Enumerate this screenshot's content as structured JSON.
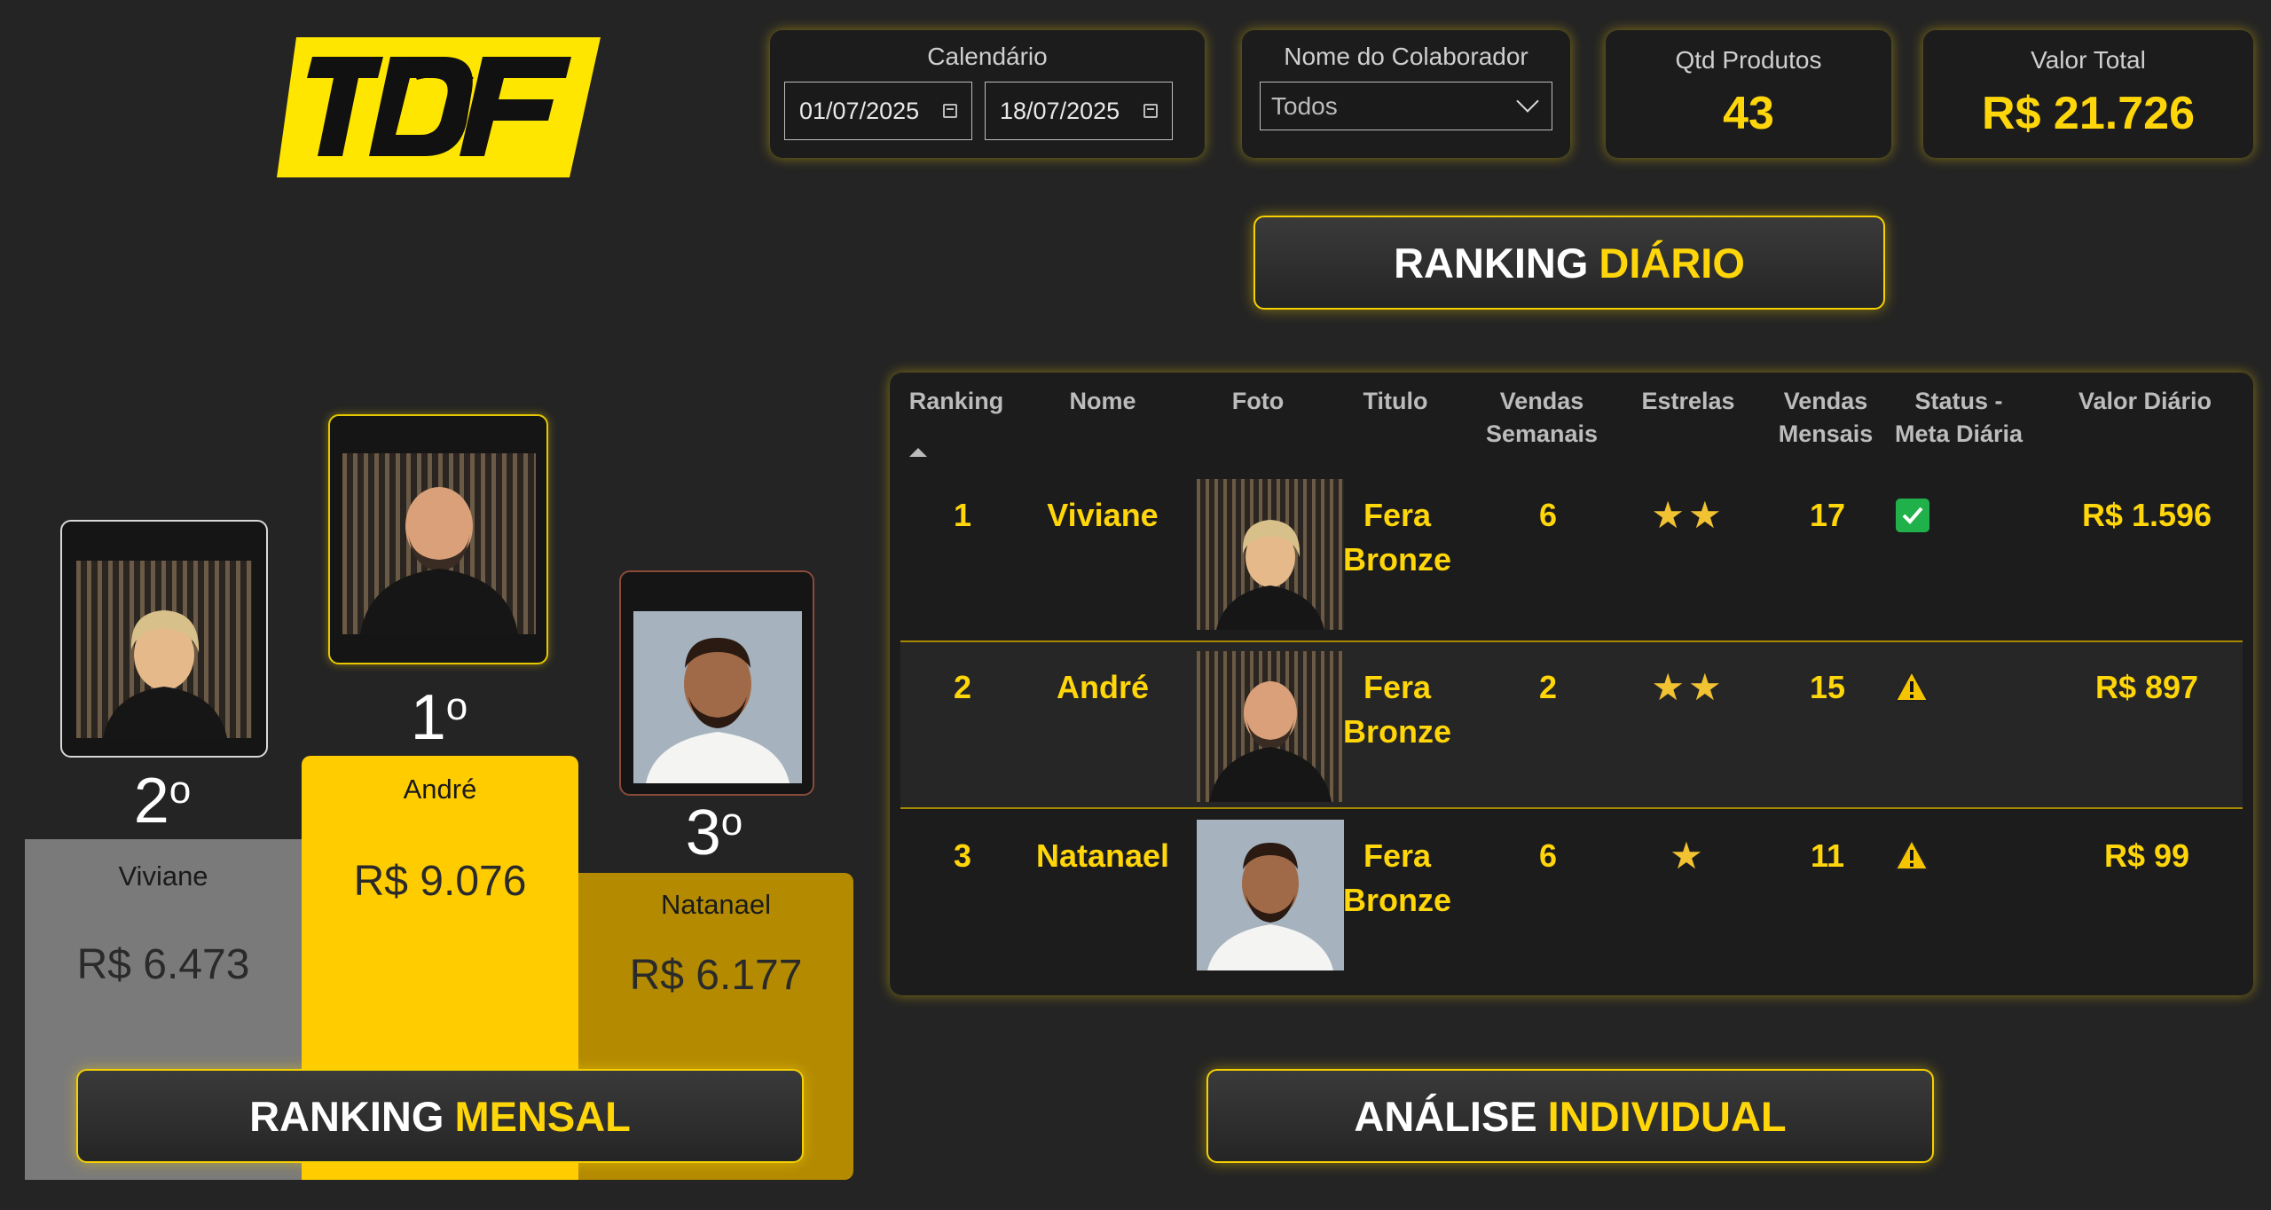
{
  "filters": {
    "calendar_title": "Calendário",
    "date_start": "01/07/2025",
    "date_end": "18/07/2025",
    "collaborator_title": "Nome do Colaborador",
    "collaborator_value": "Todos"
  },
  "kpis": {
    "qtd_title": "Qtd Produtos",
    "qtd_value": "43",
    "valor_title": "Valor Total",
    "valor_value": "R$ 21.726"
  },
  "banners": {
    "diario_white": "RANKING",
    "diario_yellow": "DIÁRIO",
    "mensal_white": "RANKING",
    "mensal_yellow": "MENSAL",
    "analise_white": "ANÁLISE",
    "analise_yellow": "INDIVIDUAL"
  },
  "podium": {
    "first": {
      "place": "1",
      "ordinal": "o",
      "name": "André",
      "value": "R$ 9.076",
      "color": "#ffcc00"
    },
    "second": {
      "place": "2",
      "ordinal": "o",
      "name": "Viviane",
      "value": "R$ 6.473",
      "color": "#7a7a7a"
    },
    "third": {
      "place": "3",
      "ordinal": "o",
      "name": "Natanael",
      "value": "R$ 6.177",
      "color": "#b38a00"
    }
  },
  "table": {
    "headers": {
      "ranking": "Ranking",
      "nome": "Nome",
      "foto": "Foto",
      "titulo": "Titulo",
      "vendas_semanais_1": "Vendas",
      "vendas_semanais_2": "Semanais",
      "estrelas": "Estrelas",
      "vendas_mensais_1": "Vendas",
      "vendas_mensais_2": "Mensais",
      "status_1": "Status -",
      "status_2": "Meta Diária",
      "valor": "Valor Diário"
    },
    "rows": [
      {
        "rank": "1",
        "nome": "Viviane",
        "titulo_1": "Fera",
        "titulo_2": "Bronze",
        "semanais": "6",
        "stars": "★★",
        "mensais": "17",
        "status": "ok",
        "valor": "R$ 1.596"
      },
      {
        "rank": "2",
        "nome": "André",
        "titulo_1": "Fera",
        "titulo_2": "Bronze",
        "semanais": "2",
        "stars": "★★",
        "mensais": "15",
        "status": "warning",
        "valor": "R$ 897"
      },
      {
        "rank": "3",
        "nome": "Natanael",
        "titulo_1": "Fera",
        "titulo_2": "Bronze",
        "semanais": "6",
        "stars": "★",
        "mensais": "11",
        "status": "warning",
        "valor": "R$ 99"
      }
    ]
  },
  "logo_text": "TDF"
}
